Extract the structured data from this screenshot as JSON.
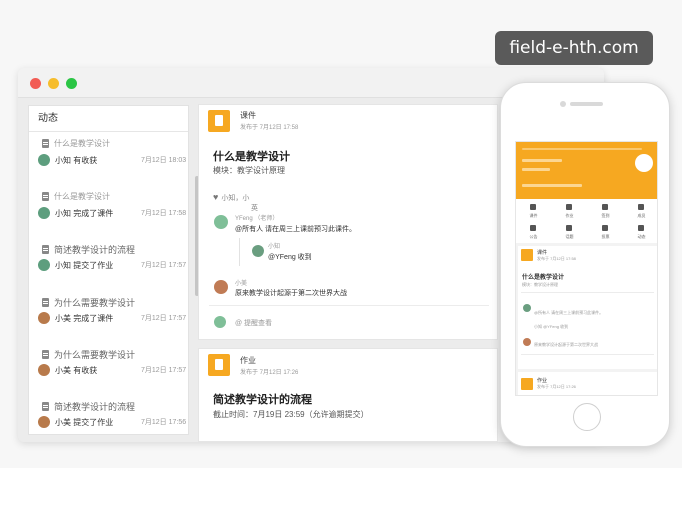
{
  "watermark": "field-e-hth.com",
  "feed": {
    "header": "动态",
    "items": [
      {
        "title": "什么是教学设计",
        "user": "小知",
        "action": "有收获",
        "time": "7月12日 18:03",
        "avatar": "boy"
      },
      {
        "title": "什么是教学设计",
        "user": "小知",
        "action": "完成了课件",
        "time": "7月12日 17:58",
        "avatar": "boy"
      },
      {
        "title": "简述教学设计的流程",
        "user": "小知",
        "action": "提交了作业",
        "time": "7月12日 17:57",
        "avatar": "boy"
      },
      {
        "title": "为什么需要教学设计",
        "user": "小美",
        "action": "完成了课件",
        "time": "7月12日 17:57",
        "avatar": "girl"
      },
      {
        "title": "为什么需要教学设计",
        "user": "小美",
        "action": "有收获",
        "time": "7月12日 17:57",
        "avatar": "girl"
      },
      {
        "title": "简述教学设计的流程",
        "user": "小美",
        "action": "提交了作业",
        "time": "7月12日 17:56",
        "avatar": "girl"
      }
    ]
  },
  "card": {
    "type": "课件",
    "meta": "发布于 7月12日 17:58",
    "title": "什么是教学设计",
    "module": "模块：教学设计原理",
    "likes_line1": "小知，小",
    "likes_line2": "英",
    "comments": [
      {
        "name": "YFeng （老师）",
        "text": "@所有人 请在周三上课前预习此课件。"
      },
      {
        "name": "小知",
        "text": "@YFeng 收到"
      },
      {
        "name": "小美",
        "text": "原来教学设计起源于第二次世界大战"
      }
    ],
    "remind": "@ 提醒查看"
  },
  "card2": {
    "type": "作业",
    "meta": "发布于 7月12日 17:26",
    "title": "简述教学设计的流程",
    "deadline": "截止时间：7月19日 23:59（允许逾期提交）"
  },
  "phone": {
    "grid_labels": [
      "课件",
      "作业",
      "签到",
      "成员",
      "公告",
      "话题",
      "投票",
      "动态"
    ],
    "card_type": "课件",
    "card_meta": "发布于 7月12日 17:58",
    "card_title": "什么是教学设计",
    "card_module": "模块：教学设计原理",
    "comment1": "@所有人 请在周三上课前预习此课件。",
    "comment2": "小知 @YFeng 收到",
    "comment3": "原来教学设计起源于第二次世界大战",
    "card2_type": "作业",
    "card2_meta": "发布于 7月12日 17:26"
  }
}
